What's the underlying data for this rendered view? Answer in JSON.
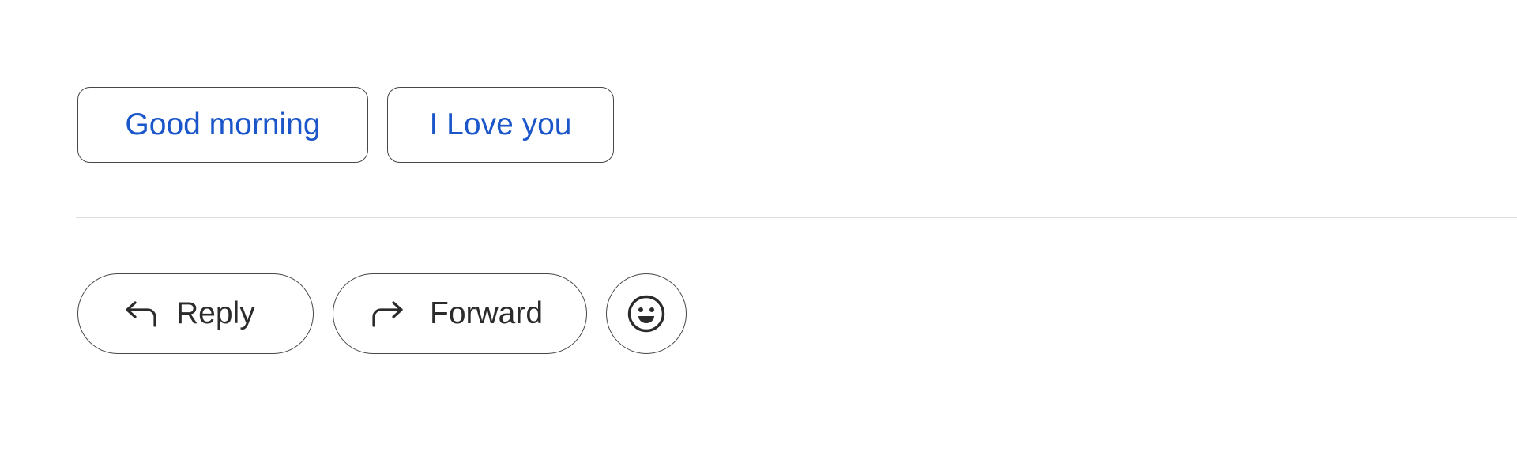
{
  "smart_replies": [
    {
      "label": "Good morning"
    },
    {
      "label": "I Love you"
    }
  ],
  "actions": {
    "reply": {
      "label": "Reply",
      "icon": "reply-icon"
    },
    "forward": {
      "label": "Forward",
      "icon": "forward-icon"
    },
    "emoji": {
      "icon": "emoji-reaction-icon"
    }
  },
  "colors": {
    "chip_text": "#1a56c9",
    "pill_text": "#2b2b2b",
    "border": "#474747",
    "divider": "#dcdcdc"
  }
}
